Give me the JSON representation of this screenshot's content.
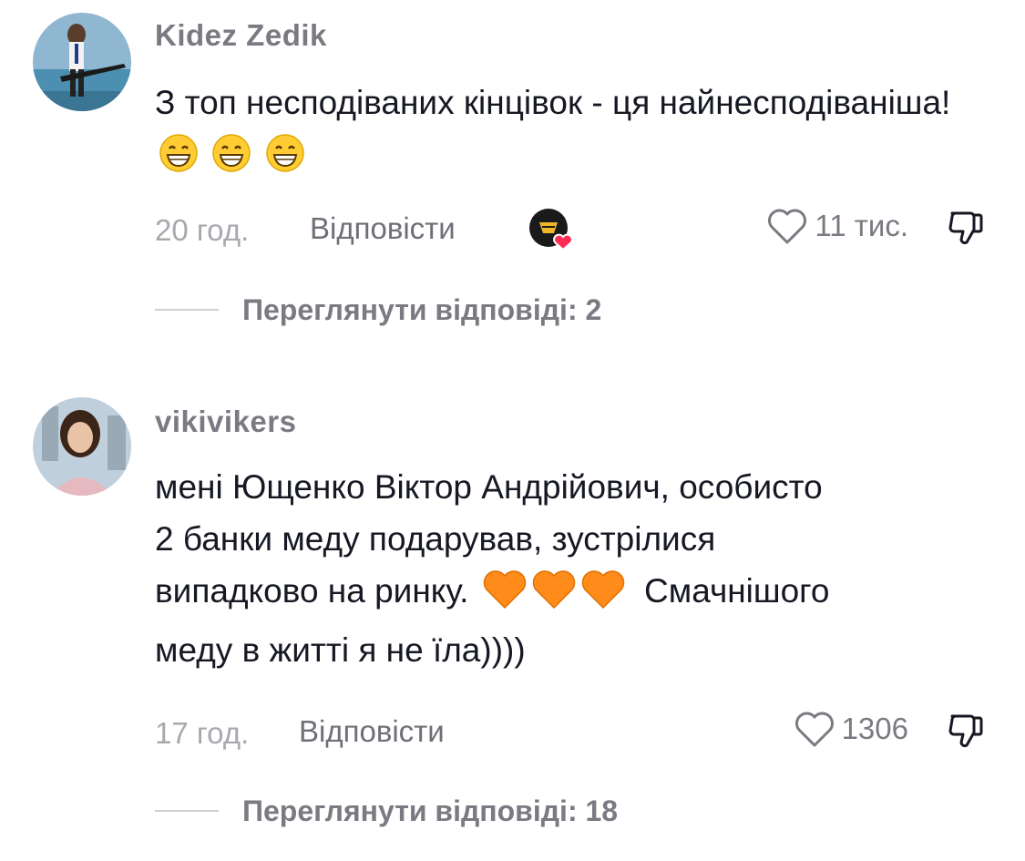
{
  "comments": [
    {
      "username": "Kidez Zedik",
      "text": "З топ несподіваних кінцівок - ця найнесподіваніша!",
      "emojis": [
        "grinning-face-emoji",
        "grinning-face-emoji",
        "grinning-face-emoji"
      ],
      "time": "20 год.",
      "reply_label": "Відповісти",
      "liked_by_creator": true,
      "likes": "11 тис.",
      "view_replies": "Переглянути відповіді: 2"
    },
    {
      "username": "vikivikers",
      "text_lines": [
        "мені Ющенко Віктор Андрійович, особисто",
        "2 банки меду подарував, зустрілися",
        "випадково на ринку.",
        "меду в житті я не їла))))"
      ],
      "text_after_emoji": "Смачнішого",
      "emojis": [
        "orange-heart-emoji",
        "orange-heart-emoji",
        "orange-heart-emoji"
      ],
      "time": "17 год.",
      "reply_label": "Відповісти",
      "likes": "1306",
      "view_replies": "Переглянути відповіді: 18"
    }
  ],
  "colors": {
    "username": "#7a7b82",
    "text": "#161823",
    "time": "#a8a9ae",
    "heart_badge": "#fe2c55",
    "orange_heart": "#ff8c1a",
    "emoji_yellow": "#ffcc33"
  }
}
